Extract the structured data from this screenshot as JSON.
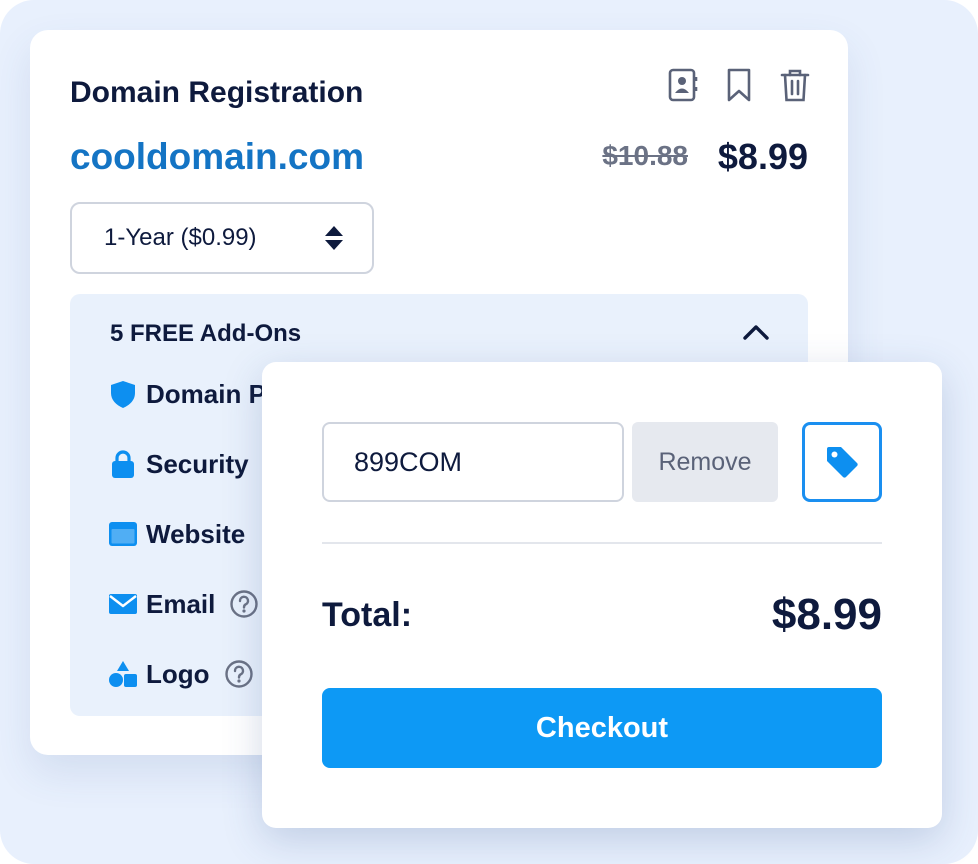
{
  "registration": {
    "title": "Domain Registration",
    "domain": "cooldomain.com",
    "old_price": "$10.88",
    "price": "$8.99",
    "term_select": {
      "value": "1-Year ($0.99)"
    },
    "header_icons": [
      "contact-card-icon",
      "bookmark-icon",
      "trash-icon"
    ]
  },
  "addons": {
    "title": "5 FREE Add-Ons",
    "items": [
      {
        "label": "Domain Privacy",
        "visible_label": "Domain P",
        "icon": "shield-icon"
      },
      {
        "label": "Security",
        "icon": "lock-icon"
      },
      {
        "label": "Website",
        "icon": "browser-window-icon"
      },
      {
        "label": "Email",
        "icon": "envelope-icon",
        "has_help": true
      },
      {
        "label": "Logo",
        "icon": "shapes-icon",
        "has_help": true
      }
    ]
  },
  "checkout": {
    "promo_code": "899COM",
    "remove_label": "Remove",
    "total_label": "Total:",
    "total_value": "$8.99",
    "checkout_label": "Checkout"
  },
  "colors": {
    "background": "#e8f0fd",
    "accent": "#0d99f5",
    "domain_link": "#1474c4",
    "text_dark": "#0e1a3d",
    "addons_panel": "#e9f1fc"
  }
}
